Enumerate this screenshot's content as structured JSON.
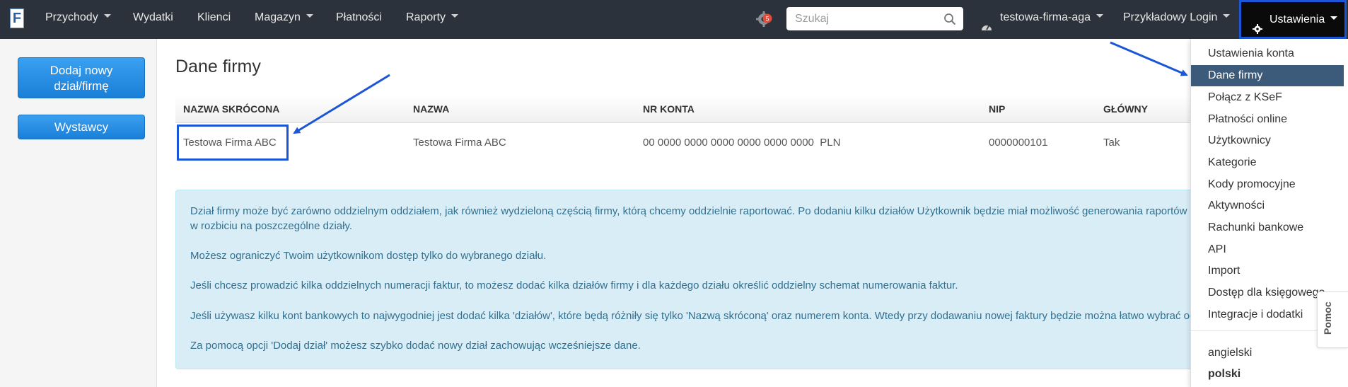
{
  "nav": {
    "logo": "F",
    "items": [
      {
        "label": "Przychody",
        "caret": true
      },
      {
        "label": "Wydatki",
        "caret": false
      },
      {
        "label": "Klienci",
        "caret": false
      },
      {
        "label": "Magazyn",
        "caret": true
      },
      {
        "label": "Płatności",
        "caret": false
      },
      {
        "label": "Raporty",
        "caret": true
      }
    ],
    "notification_count": "5",
    "search_placeholder": "Szukaj",
    "company": "testowa-firma-aga",
    "user": "Przykładowy Login",
    "settings": "Ustawienia"
  },
  "sidebar": {
    "add_button": "Dodaj nowy dział/firmę",
    "issuers_button": "Wystawcy"
  },
  "main": {
    "title": "Dane firmy",
    "columns": [
      "NAZWA SKRÓCONA",
      "NAZWA",
      "NR KONTA",
      "NIP",
      "GŁÓWNY"
    ],
    "row": {
      "short_name": "Testowa Firma ABC",
      "name": "Testowa Firma ABC",
      "account": "00 0000 0000 0000 0000 0000 0000  PLN",
      "nip": "0000000101",
      "main": "Tak"
    },
    "info": [
      "Dział firmy może być zarówno oddzielnym oddziałem, jak również wydzieloną częścią firmy, którą chcemy oddzielnie raportować. Po dodaniu kilku działów Użytkownik będzie miał możliwość generowania raportów",
      "w rozbiciu na poszczególne działy.",
      "Możesz ograniczyć Twoim użytkownikom dostęp tylko do wybranego działu.",
      "Jeśli chcesz prowadzić kilka oddzielnych numeracji faktur, to możesz dodać kilka działów firmy i dla każdego działu określić oddzielny schemat numerowania faktur.",
      "Jeśli używasz kilku kont bankowych to najwygodniej jest dodać kilka 'działów', które będą różniły się tylko 'Nazwą skróconą' oraz numerem konta. Wtedy przy dodawaniu nowej faktury będzie można łatwo wybrać od",
      "Za pomocą opcji 'Dodaj dział' możesz szybko dodać nowy dział zachowując wcześniejsze dane."
    ]
  },
  "dropdown": {
    "items": [
      "Ustawienia konta",
      "Dane firmy",
      "Połącz z KSeF",
      "Płatności online",
      "Użytkownicy",
      "Kategorie",
      "Kody promocyjne",
      "Aktywności",
      "Rachunki bankowe",
      "API",
      "Import",
      "Dostęp dla księgowego",
      "Integracje i dodatki"
    ],
    "active_index": 1,
    "languages": [
      "angielski",
      "polski"
    ],
    "active_language_index": 1
  },
  "help_tab": "Pomoc",
  "colors": {
    "nav_bg": "#2b323b",
    "accent_blue": "#1a56d6",
    "button_blue": "#1a7fd8",
    "active_item": "#3c5a7a",
    "info_bg": "#d9edf7",
    "info_text": "#31708f"
  }
}
